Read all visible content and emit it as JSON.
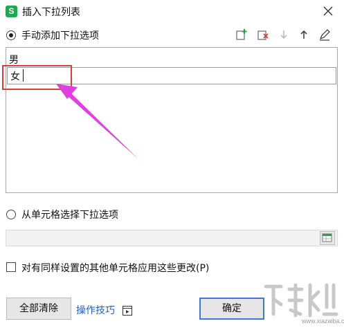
{
  "window": {
    "title": "插入下拉列表",
    "app_icon_letter": "S"
  },
  "manual": {
    "label": "手动添加下拉选项",
    "checked": true
  },
  "toolbar": {
    "icons": [
      "add-item-icon",
      "delete-item-icon",
      "move-down-icon",
      "move-up-icon",
      "edit-icon"
    ]
  },
  "list": {
    "items": [
      "男"
    ],
    "editing_value": "女"
  },
  "from_cells": {
    "label": "从单元格选择下拉选项",
    "checked": false,
    "value": ""
  },
  "apply_all": {
    "label": "对有同样设置的其他单元格应用这些更改(P)",
    "checked": false
  },
  "buttons": {
    "clear_all": "全部清除",
    "tips_link": "操作技巧",
    "ok": "确定"
  },
  "watermark": {
    "text": "www.xiazaiba.com"
  },
  "colors": {
    "accent": "#3b78d8",
    "annotation_red": "#e03a3a",
    "annotation_arrow": "#e040e0",
    "app_green": "#1fa84d"
  }
}
